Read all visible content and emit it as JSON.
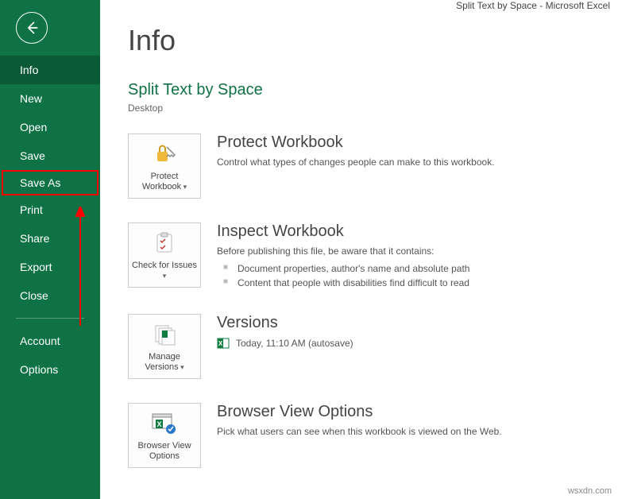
{
  "window": {
    "title": "Split Text by Space - Microsoft Excel"
  },
  "sidebar": {
    "items": [
      {
        "label": "Info",
        "active": true
      },
      {
        "label": "New"
      },
      {
        "label": "Open"
      },
      {
        "label": "Save"
      },
      {
        "label": "Save As",
        "highlighted": true
      },
      {
        "label": "Print"
      },
      {
        "label": "Share"
      },
      {
        "label": "Export"
      },
      {
        "label": "Close"
      }
    ],
    "footer": [
      {
        "label": "Account"
      },
      {
        "label": "Options"
      }
    ]
  },
  "main": {
    "heading": "Info",
    "doc_title": "Split Text by Space",
    "doc_location": "Desktop",
    "sections": {
      "protect": {
        "tile_label": "Protect Workbook",
        "title": "Protect Workbook",
        "desc": "Control what types of changes people can make to this workbook."
      },
      "inspect": {
        "tile_label": "Check for Issues",
        "title": "Inspect Workbook",
        "desc": "Before publishing this file, be aware that it contains:",
        "bullets": [
          "Document properties, author's name and absolute path",
          "Content that people with disabilities find difficult to read"
        ]
      },
      "versions": {
        "tile_label": "Manage Versions",
        "title": "Versions",
        "entry": "Today, 11:10 AM (autosave)"
      },
      "browser": {
        "tile_label": "Browser View Options",
        "title": "Browser View Options",
        "desc": "Pick what users can see when this workbook is viewed on the Web."
      }
    }
  },
  "watermark": "wsxdn.com"
}
